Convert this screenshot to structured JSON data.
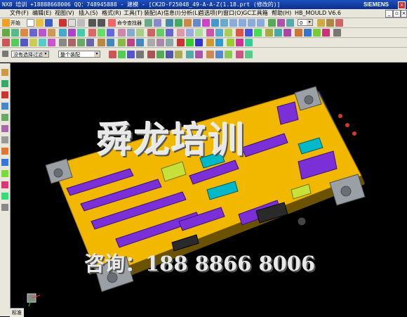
{
  "window": {
    "title": "NX8 培训 +18888668006 QQ：748945888 - 建模 - [CK2D-F25048_49-A-A-Z(1.18.prt (修改的)]",
    "brand": "SIEMENS",
    "close_glyph": "x"
  },
  "menu": {
    "items": [
      "文件(F)",
      "编辑(E)",
      "视图(V)",
      "插入(S)",
      "格式(R)",
      "工具(T)",
      "装配(A)",
      "信息(I)",
      "分析(L)",
      "首选项(P)",
      "窗口(O)",
      "GC工具箱",
      "帮助(H)",
      "HB_MOULD V6.6"
    ]
  },
  "toolbar": {
    "start_label": "开始",
    "command_finder_label": "命令查找器",
    "layer_value": "0",
    "filter_label": "没有选择过滤器",
    "assembly_label": "整个装配"
  },
  "viewport": {
    "watermark_main": "舜龙培训",
    "watermark_phone": "咨询：188 8866 8006"
  },
  "bottom_tab": {
    "label": "标准"
  },
  "colors": {
    "plate_yellow": "#f2b800",
    "insert_purple": "#7b2fd6",
    "slider_cyan": "#00b8c8",
    "base_blue": "#1f3fa8",
    "grey_steel": "#9aa0a6"
  }
}
